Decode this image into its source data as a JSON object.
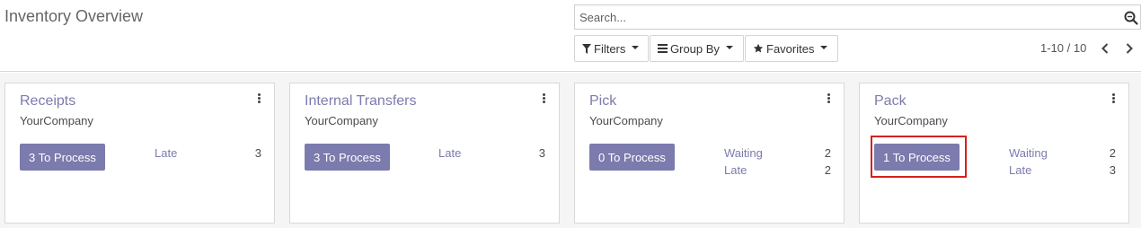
{
  "header": {
    "title": "Inventory Overview",
    "search_placeholder": "Search...",
    "filters_label": "Filters",
    "groupby_label": "Group By",
    "favorites_label": "Favorites",
    "pager_text": "1-10 / 10"
  },
  "cards": [
    {
      "title": "Receipts",
      "company": "YourCompany",
      "process_label": "3 To Process",
      "stats": [
        {
          "label": "Late",
          "value": "3"
        }
      ]
    },
    {
      "title": "Internal Transfers",
      "company": "YourCompany",
      "process_label": "3 To Process",
      "stats": [
        {
          "label": "Late",
          "value": "3"
        }
      ]
    },
    {
      "title": "Pick",
      "company": "YourCompany",
      "process_label": "0 To Process",
      "stats": [
        {
          "label": "Waiting",
          "value": "2"
        },
        {
          "label": "Late",
          "value": "2"
        }
      ]
    },
    {
      "title": "Pack",
      "company": "YourCompany",
      "process_label": "1 To Process",
      "stats": [
        {
          "label": "Waiting",
          "value": "2"
        },
        {
          "label": "Late",
          "value": "3"
        }
      ]
    }
  ],
  "colors": {
    "brand": "#7c7bad",
    "highlight": "#d62020"
  },
  "icons": {
    "search": "search-icon",
    "filter": "filter-icon",
    "groupby": "bars-icon",
    "favorites": "star-icon",
    "prev": "chevron-left-icon",
    "next": "chevron-right-icon",
    "card_menu": "vertical-dots-icon"
  }
}
